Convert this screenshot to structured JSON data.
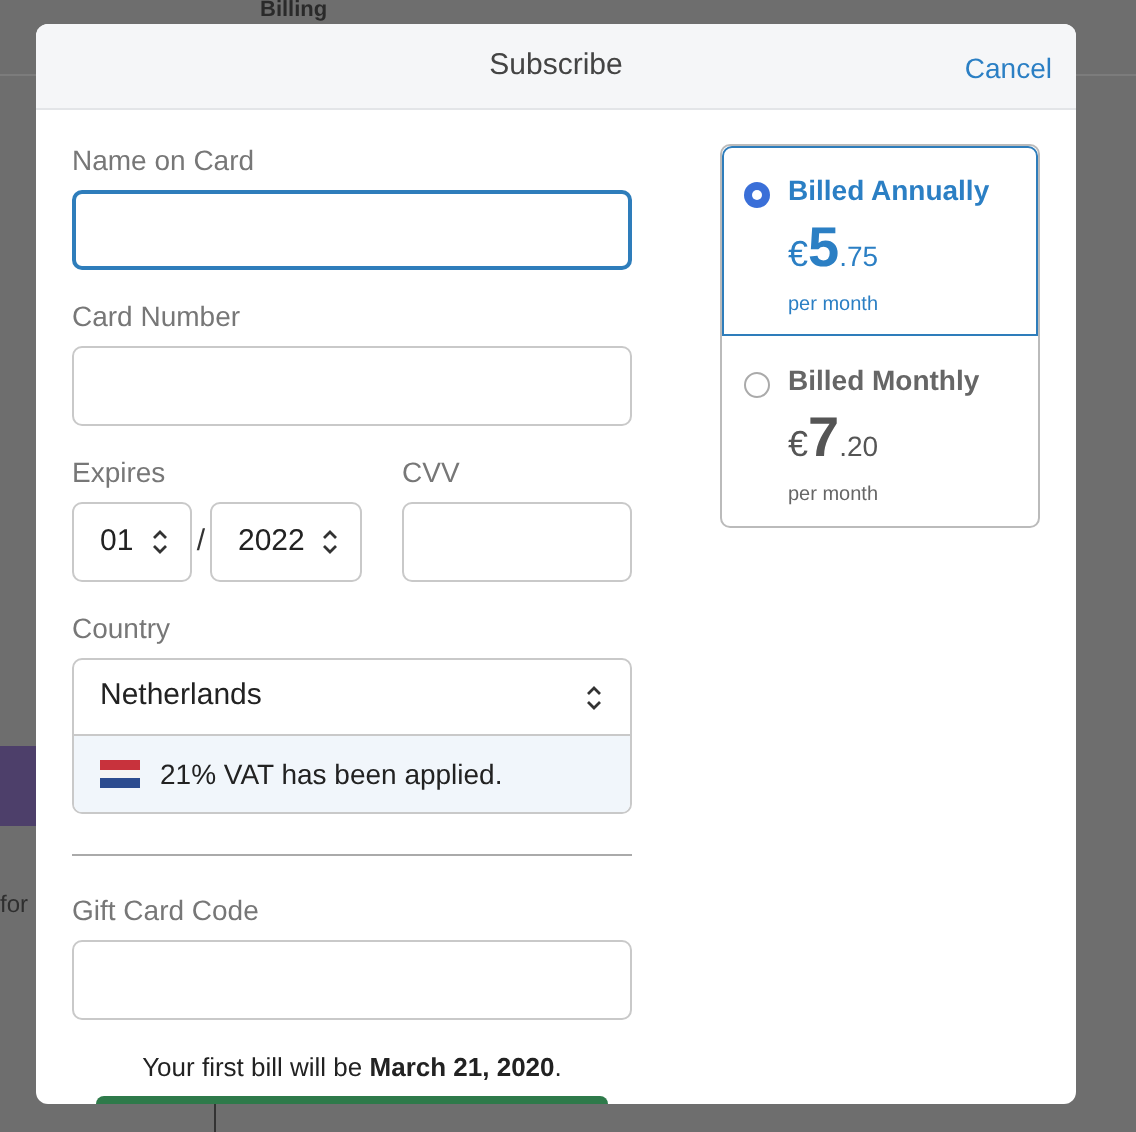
{
  "background": {
    "title": "Billing",
    "fragments": [
      "for"
    ]
  },
  "dialog": {
    "title": "Subscribe",
    "cancel": "Cancel",
    "fields": [
      {
        "label": "Name on Card",
        "focused": true
      },
      {
        "label": "Card Number",
        "focused": false
      }
    ],
    "expires": {
      "label": "Expires",
      "month": "01",
      "separator": "/",
      "year": "2022"
    },
    "cvv": {
      "label": "CVV"
    },
    "country": {
      "label": "Country",
      "value": "Netherlands",
      "note": "21% VAT has been applied."
    },
    "gift_card": {
      "label": "Gift Card Code"
    },
    "first_bill": "Your first bill will be **March 21, 2020**.",
    "plans": [
      {
        "name": "Billed Annually",
        "currency": "€",
        "whole": "5",
        "fraction": ".75",
        "period": "per month",
        "selected": true
      },
      {
        "name": "Billed Monthly",
        "currency": "€",
        "whole": "7",
        "fraction": ".20",
        "period": "per month",
        "selected": false
      }
    ]
  }
}
